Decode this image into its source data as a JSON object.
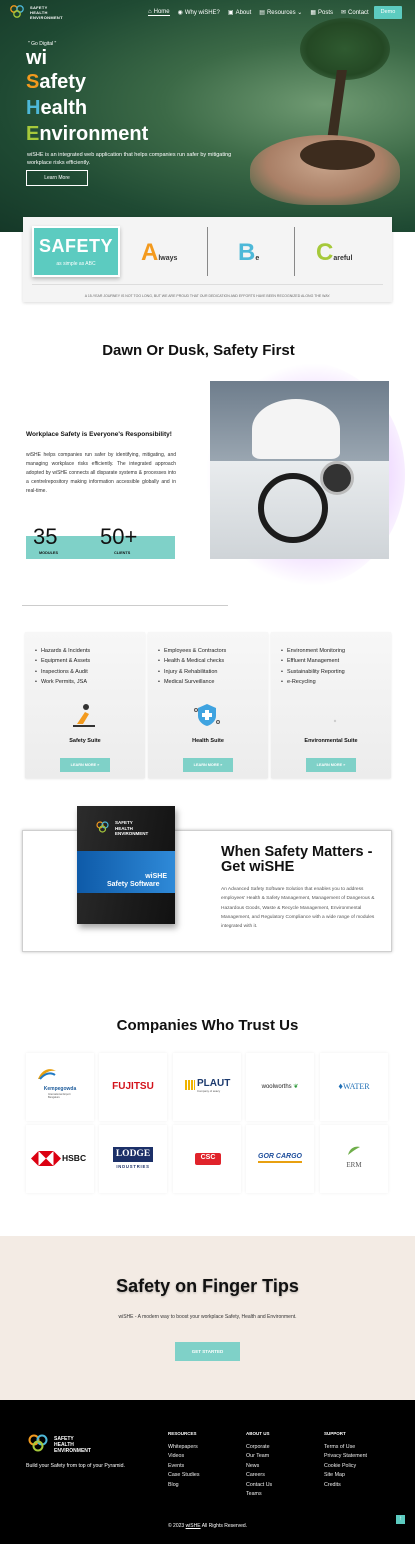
{
  "colors": {
    "accent": "#5ccbc0",
    "orange": "#f39a1e",
    "blue": "#4db8d8",
    "green": "#a6c93b"
  },
  "nav": {
    "logo_lines": [
      "SAFETY",
      "HEALTH",
      "ENVIRONMENT"
    ],
    "items": [
      {
        "icon": "home-icon",
        "label": "Home"
      },
      {
        "icon": "globe-icon",
        "label": "Why wiSHE?"
      },
      {
        "icon": "briefcase-icon",
        "label": "About"
      },
      {
        "icon": "book-icon",
        "label": "Resources"
      },
      {
        "icon": "news-icon",
        "label": "Posts"
      },
      {
        "icon": "mail-icon",
        "label": "Contact"
      }
    ],
    "demo_label": "Demo"
  },
  "hero": {
    "eyebrow": "\" Go Digital \"",
    "wi": "wi",
    "lines": [
      {
        "cap": "S",
        "rest": "afety"
      },
      {
        "cap": "H",
        "rest": "ealth"
      },
      {
        "cap": "E",
        "rest": "nvironment"
      }
    ],
    "description": "wiSHE is an integrated web application that helps companies run safer by mitigating workplace risks efficiently.",
    "learn_more": "Learn More"
  },
  "safety_card": {
    "title": "SAFETY",
    "subtitle": "as simple as ABC",
    "a_cap": "A",
    "a_rest": "lways",
    "b_cap": "B",
    "b_rest": "e",
    "c_cap": "C",
    "c_rest": "areful",
    "note": "A 15-YEAR JOURNEY IS NOT TOO LONG, BUT WE ARE PROUD THAT OUR DEDICATION AND EFFORTS HAVE BEEN RECOGNIZED ALONG THE WAY."
  },
  "dawn": {
    "title": "Dawn Or Dusk, Safety First",
    "subtitle": "Workplace Safety is Everyone's Responsibility!",
    "description": "wiSHE helps companies run safer by identifying, mitigating, and managing workplace risks efficiently. The integrated approach adopted by wiSHE connects all disparate systems & processes into a centrelrepository making information accessible globally and in real-time.",
    "stats": [
      {
        "value": "35",
        "label": "MODULES"
      },
      {
        "value": "50+",
        "label": "CLIENTS"
      }
    ]
  },
  "suites": [
    {
      "items": [
        "Hazards & Incidents",
        "Equipment & Assets",
        "Inspections & Audit",
        "Work Permits, JSA"
      ],
      "name": "Safety Suite",
      "icon": "worker-icon",
      "button": "LEARN MORE"
    },
    {
      "items": [
        "Employees & Contractors",
        "Health & Medical checks",
        "Injury & Rehabilitation",
        "Medical Surveillance"
      ],
      "name": "Health Suite",
      "icon": "medical-shield-icon",
      "button": "LEARN MORE"
    },
    {
      "items": [
        "Environment Monitoring",
        "Effluent Management",
        "Sustainability Reporting",
        "e-Recycling"
      ],
      "name": "Environmental Suite",
      "icon": "leaf-icon",
      "button": "LEARN MORE"
    }
  ],
  "when": {
    "title": "When Safety Matters - Get wiSHE",
    "description": "An Advanced Safety Software Solution that enables you to address employees' Health & Safety Management, Management of Dangerous & Hazardous Goods, Waste & Recycle Management, Environmental Management, and Regulatory Compliance with a wide range of modules integrated with it.",
    "box_brand": "wiSHE",
    "box_product": "Safety Software"
  },
  "companies": {
    "title": "Companies Who Trust Us",
    "logos": [
      "Kempegowda",
      "FUJITSU",
      "PLAUT",
      "woolworths",
      "WATER",
      "HSBC",
      "LODGE",
      "CSC",
      "GOR CARGO",
      "ERM"
    ],
    "kempegowda_sub": "International Airport Bengaluru",
    "plaut_sub": "Company of avacy",
    "lodge_sub": "INDUSTRIES"
  },
  "finger": {
    "title": "Safety on Finger Tips",
    "subtitle": "wiSHE - A modern way to boost your workplace  Safety, Health and Environment.",
    "button": "GET STARTED"
  },
  "footer": {
    "tagline": "Build your Safety from top of your Pyramid.",
    "columns": [
      {
        "title": "RESOURCES",
        "links": [
          "Whitepapers",
          "Videos",
          "Events",
          "Case Studies",
          "Blog"
        ]
      },
      {
        "title": "ABOUT US",
        "links": [
          "Corporate",
          "Our Team",
          "News",
          "Careers",
          "Contact Us",
          "Teams"
        ]
      },
      {
        "title": "SUPPORT",
        "links": [
          "Terms of Use",
          "Privacy Statement",
          "Cookie Policy",
          "Site Map",
          "Credits"
        ]
      }
    ],
    "copyright_prefix": "© 2023",
    "copyright_brand": "wiSHE",
    "copyright_suffix": "All Rights Reserved."
  }
}
